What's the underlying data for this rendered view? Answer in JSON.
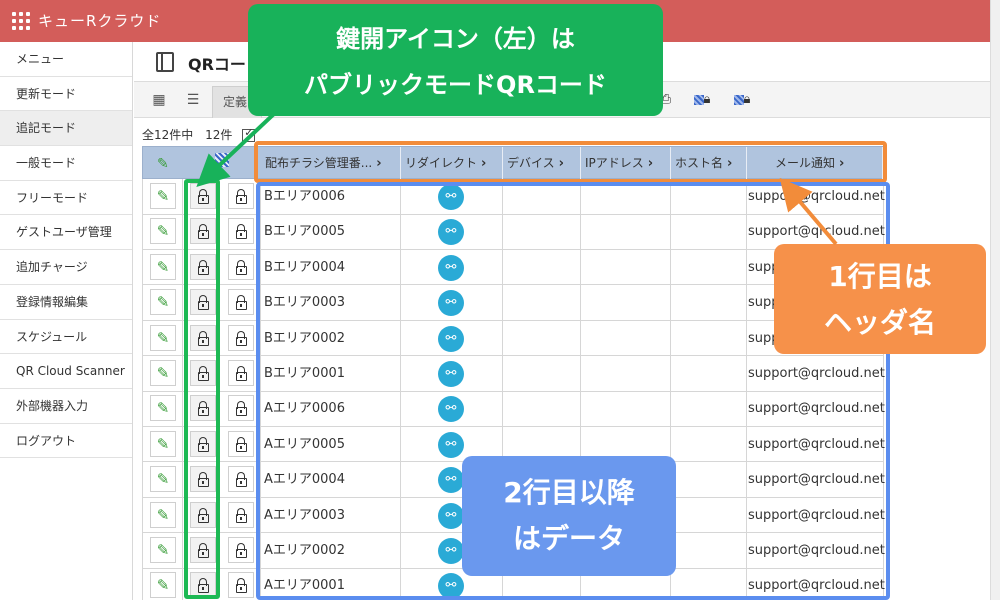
{
  "app": {
    "title": "キューRクラウド"
  },
  "sidebar": {
    "items": [
      {
        "label": "メニュー",
        "active": false
      },
      {
        "label": "更新モード",
        "active": false
      },
      {
        "label": "追記モード",
        "active": true
      },
      {
        "label": "一般モード",
        "active": false
      },
      {
        "label": "フリーモード",
        "active": false
      },
      {
        "label": "ゲストユーザ管理",
        "active": false
      },
      {
        "label": "追加チャージ",
        "active": false
      },
      {
        "label": "登録情報編集",
        "active": false
      },
      {
        "label": "スケジュール",
        "active": false
      },
      {
        "label": "QR Cloud Scanner",
        "active": false
      },
      {
        "label": "外部機器入力",
        "active": false
      },
      {
        "label": "ログアウト",
        "active": false
      }
    ]
  },
  "page": {
    "title": "QRコー"
  },
  "toolbar": {
    "tab_label": "定義"
  },
  "counts": {
    "total": "全12件中",
    "shown": "12件"
  },
  "table": {
    "headers": [
      "配布チラシ管理番...",
      "リダイレクト",
      "デバイス",
      "IPアドレス",
      "ホスト名",
      "メール通知"
    ],
    "rows": [
      {
        "name": "Bエリア0006",
        "email": "support@qrcloud.net"
      },
      {
        "name": "Bエリア0005",
        "email": "support@qrcloud.net"
      },
      {
        "name": "Bエリア0004",
        "email": "supp"
      },
      {
        "name": "Bエリア0003",
        "email": "supp"
      },
      {
        "name": "Bエリア0002",
        "email": "supp"
      },
      {
        "name": "Bエリア0001",
        "email": "support@qrcloud.net"
      },
      {
        "name": "Aエリア0006",
        "email": "support@qrcloud.net"
      },
      {
        "name": "Aエリア0005",
        "email": "support@qrcloud.net"
      },
      {
        "name": "Aエリア0004",
        "email": "support@qrcloud.net"
      },
      {
        "name": "Aエリア0003",
        "email": "support@qrcloud.net"
      },
      {
        "name": "Aエリア0002",
        "email": "support@qrcloud.net"
      },
      {
        "name": "Aエリア0001",
        "email": "support@qrcloud.net"
      }
    ]
  },
  "annotations": {
    "green_line1": "鍵開アイコン（左）は",
    "green_line2": "パブリックモードQRコード",
    "orange_line1": "1行目は",
    "orange_line2": "ヘッダ名",
    "blue_line1": "2行目以降",
    "blue_line2": "はデータ"
  },
  "colors": {
    "topbar": "#d35d5a",
    "header_row": "#b0c4de",
    "green_annotation": "#18b25a",
    "orange_annotation": "#f6914a",
    "blue_annotation": "#6a98ee",
    "link_icon": "#2aaad6"
  }
}
